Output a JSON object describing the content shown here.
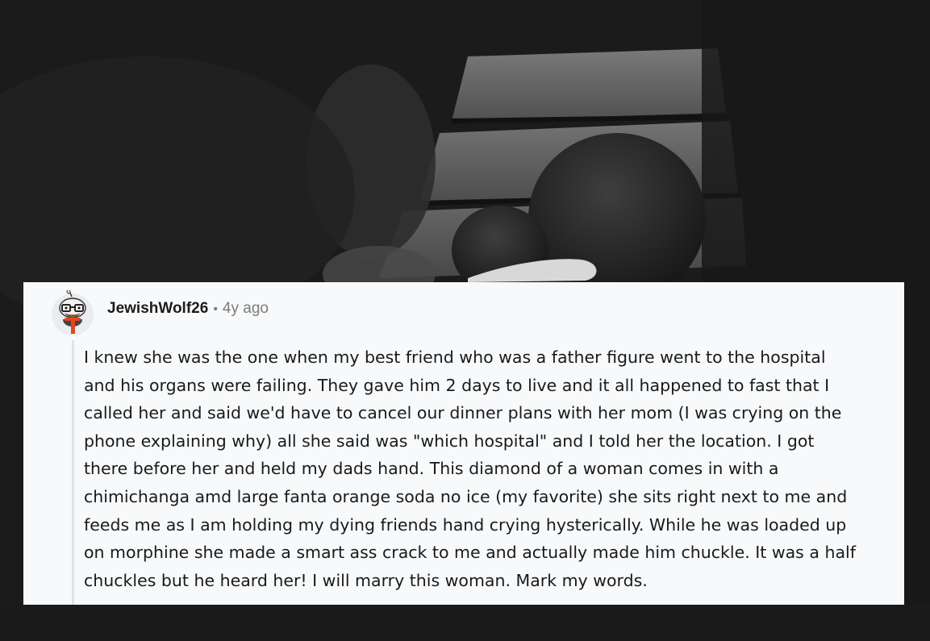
{
  "comment": {
    "username": "JewishWolf26",
    "separator": "•",
    "age": "4y ago",
    "body_lines": [
      "I knew she was the one when my best friend who was a father figure went to the hospital",
      "and his organs were failing. They gave him 2 days to live and it all happened to fast that I",
      "called her and said we'd have to cancel our dinner plans with her mom (I was crying on the",
      "phone explaining why) all she said was \"which hospital\" and I told her the location. I got",
      "there before her and held my dads hand. This diamond of a woman comes in with a",
      "chimichanga amd large fanta orange soda no ice (my favorite) she sits right next to me and",
      "feeds me as I am holding my dying friends hand crying hysterically. While he was loaded up",
      "on morphine she made a smart ass crack to me and actually made him chuckle. It was a half",
      "chuckles but he heard her! I will marry this woman. Mark my words."
    ]
  },
  "icons": {
    "avatar": "snoo-avatar-icon"
  },
  "colors": {
    "card_background": "#f7f9fa",
    "text": "#1a1a1b",
    "meta_text": "#7c7c7c",
    "thread_line": "#dde3e8",
    "avatar_scarf": "#e0461f"
  }
}
